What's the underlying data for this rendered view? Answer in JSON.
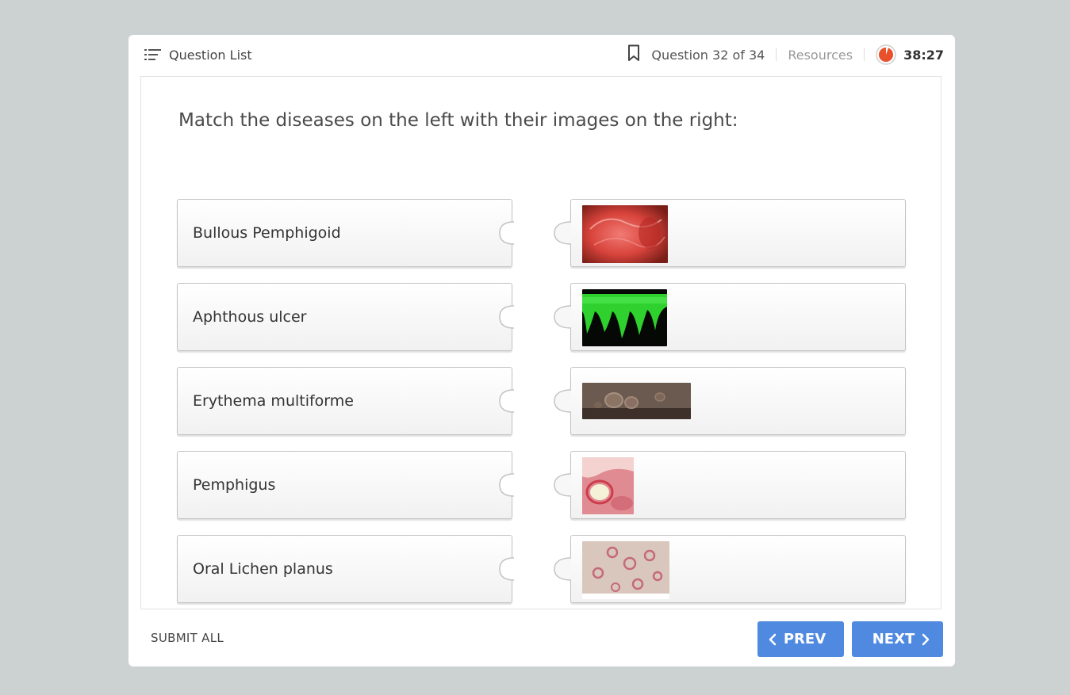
{
  "header": {
    "question_list_label": "Question List",
    "question_counter": "Question 32 of 34",
    "resources_label": "Resources",
    "timer": "38:27"
  },
  "question": {
    "prompt": "Match the diseases on the left with their images on the right:",
    "left_items": [
      {
        "label": "Bullous Pemphigoid"
      },
      {
        "label": "Aphthous ulcer"
      },
      {
        "label": "Erythema multiforme"
      },
      {
        "label": "Pemphigus"
      },
      {
        "label": "Oral Lichen planus"
      }
    ],
    "right_items": [
      {
        "image": "red-oral-mucosa-lesion-image"
      },
      {
        "image": "green-immunofluorescence-image"
      },
      {
        "image": "blisters-on-dark-skin-image"
      },
      {
        "image": "oral-ulcer-lip-image"
      },
      {
        "image": "target-lesions-skin-image"
      }
    ]
  },
  "footer": {
    "submit_label": "SUBMIT ALL",
    "prev_label": "PREV",
    "next_label": "NEXT"
  },
  "colors": {
    "background": "#ccd1d2",
    "button_blue": "#4f8ae0",
    "timer_orange": "#e8512c"
  },
  "icons": {
    "question_list": "list-icon",
    "bookmark": "bookmark-icon",
    "timer": "timer-icon",
    "prev": "chevron-left-icon",
    "next": "chevron-right-icon"
  }
}
